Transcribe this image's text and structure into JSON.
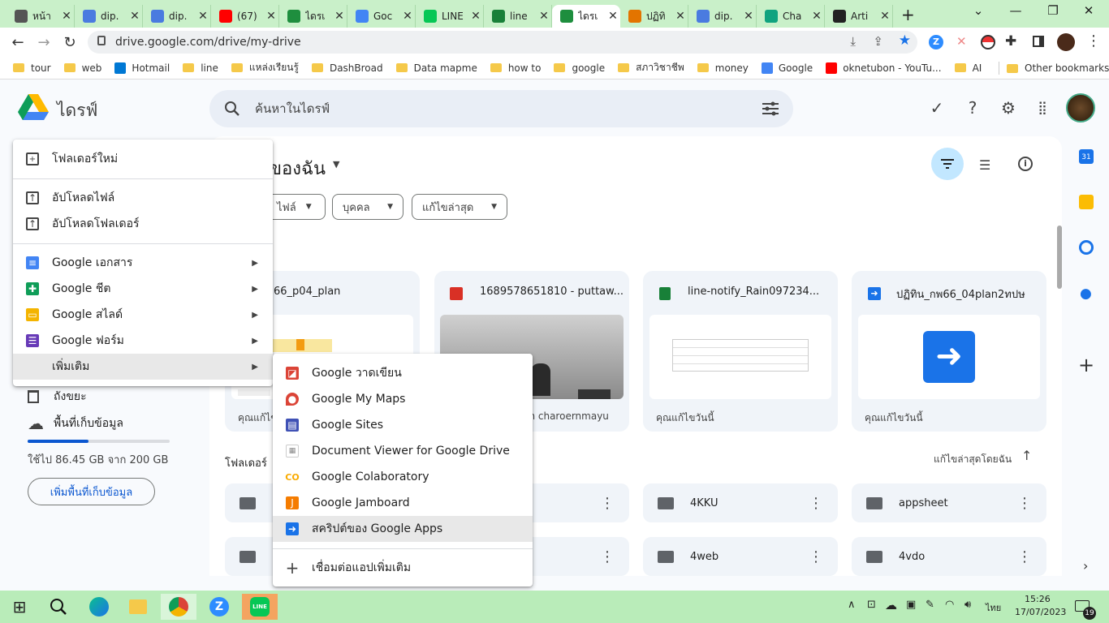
{
  "tabs": [
    {
      "label": "หน้า",
      "icon_color": "#555555"
    },
    {
      "label": "dip.",
      "icon_color": "#4a7be0"
    },
    {
      "label": "dip.",
      "icon_color": "#4a7be0"
    },
    {
      "label": "(67)",
      "icon_color": "#ff0000"
    },
    {
      "label": "ไดรเ",
      "icon_color": "#1e8e3e"
    },
    {
      "label": "Goc",
      "icon_color": "#4285f4"
    },
    {
      "label": "LINE",
      "icon_color": "#06c755"
    },
    {
      "label": "line",
      "icon_color": "#188038"
    },
    {
      "label": "ไดรเ",
      "icon_color": "#1e8e3e",
      "active": true
    },
    {
      "label": "ปฏิทิ",
      "icon_color": "#e37400"
    },
    {
      "label": "dip.",
      "icon_color": "#4a7be0"
    },
    {
      "label": "Cha",
      "icon_color": "#10a37f"
    },
    {
      "label": "Arti",
      "icon_color": "#222222"
    }
  ],
  "address": {
    "url": "drive.google.com/drive/my-drive"
  },
  "bookmarks": [
    "tour",
    "web",
    "Hotmail",
    "line",
    "แหล่งเรียนรู้",
    "DashBroad",
    "Data mapme",
    "how to",
    "google",
    "สภาวิชาชีพ",
    "money",
    "Google",
    "oknetubon - YouTu...",
    "AI"
  ],
  "other_bookmarks": "Other bookmarks",
  "drive": {
    "logo_text": "ไดรฟ์",
    "search_placeholder": "ค้นหาในไดรฟ์",
    "title": "ของฉัน",
    "chips": [
      "ไฟล์",
      "บุคคล",
      "แก้ไขล่าสุด"
    ],
    "cards": [
      {
        "title": "66_p04_plan",
        "footer": "คุณแก้ไข"
      },
      {
        "title": "1689578651810 - puttaw...",
        "footer": "van charoernmayu"
      },
      {
        "title": "line-notify_Rain097234...",
        "footer": "คุณแก้ไขวันนี้"
      },
      {
        "title": "ปฏิทิน_กพ66_04plan2ทปษ",
        "footer": "คุณแก้ไขวันนี้"
      }
    ],
    "folders_label": "โฟลเดอร์",
    "sort_label": "แก้ไขล่าสุดโดยฉัน",
    "folders": [
      "4KKU",
      "appsheet",
      "4web",
      "4vdo"
    ],
    "sidebar": {
      "trash": "ถังขยะ",
      "storage": "พื้นที่เก็บข้อมูล",
      "usage": "ใช้ไป 86.45 GB จาก 200 GB",
      "usage_fraction": 0.43,
      "buy": "เพิ่มพื้นที่เก็บข้อมูล"
    }
  },
  "menu_new": [
    {
      "label": "โฟลเดอร์ใหม่",
      "icon": "new-folder-icon"
    },
    {
      "label": "อัปโหลดไฟล์",
      "icon": "upload-file-icon"
    },
    {
      "label": "อัปโหลดโฟลเดอร์",
      "icon": "upload-folder-icon"
    },
    {
      "label": "Google เอกสาร",
      "icon": "docs-icon"
    },
    {
      "label": "Google ชีต",
      "icon": "sheets-icon"
    },
    {
      "label": "Google สไลด์",
      "icon": "slides-icon"
    },
    {
      "label": "Google ฟอร์ม",
      "icon": "forms-icon"
    },
    {
      "label": "เพิ่มเติม",
      "icon": "more-icon"
    }
  ],
  "menu_more": [
    {
      "label": "Google วาดเขียน",
      "icon": "drawings-icon"
    },
    {
      "label": "Google My Maps",
      "icon": "mymaps-icon"
    },
    {
      "label": "Google Sites",
      "icon": "sites-icon"
    },
    {
      "label": "Document Viewer for Google Drive",
      "icon": "document-viewer-icon"
    },
    {
      "label": "Google Colaboratory",
      "icon": "colab-icon"
    },
    {
      "label": "Google Jamboard",
      "icon": "jamboard-icon"
    },
    {
      "label": "สคริปต์ของ Google Apps",
      "icon": "apps-script-icon"
    },
    {
      "label": "เชื่อมต่อแอปเพิ่มเติม",
      "icon": "plus-icon"
    }
  ],
  "taskbar": {
    "lang": "ไทย",
    "time": "15:26",
    "date": "17/07/2023",
    "badge": "19"
  },
  "colors": {
    "drive_blue": "#0b57d0",
    "menu_highlight": "#e8e8e8",
    "taskbar": "#b9ecb9"
  }
}
